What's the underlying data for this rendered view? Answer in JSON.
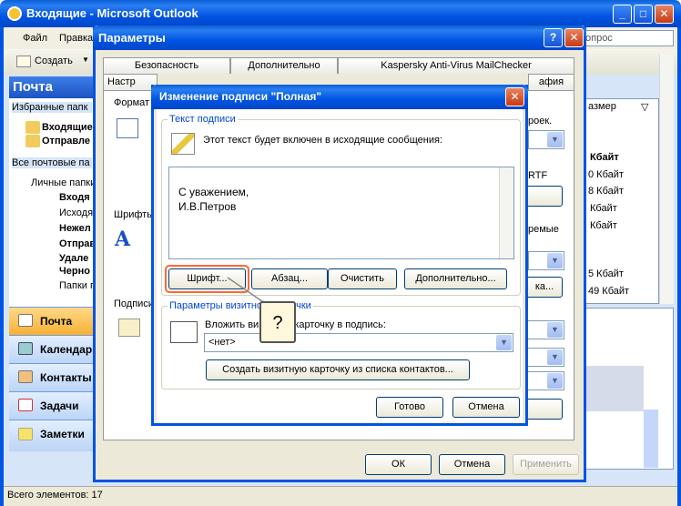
{
  "outlook": {
    "title": "Входящие - Microsoft Outlook",
    "menu": [
      "Файл",
      "Правка"
    ],
    "toolbar_create": "Создать",
    "question_placeholder": "опрос",
    "nav_header": "Почта",
    "favorites_label": "Избранные папк",
    "favorites": [
      "Входящие",
      "Отправле"
    ],
    "all_folders_label": "Все почтовые па",
    "folders": [
      "Личные папки",
      "Входя",
      "Исходя",
      "Нежел",
      "Отправ",
      "Удале",
      "Черно",
      "Папки п"
    ],
    "nav_buttons": [
      "Почта",
      "Календарь",
      "Контакты",
      "Задачи",
      "Заметки"
    ],
    "status": "Всего элементов: 17",
    "list_header_size": "азмер",
    "list_header_col": "Кбайт",
    "sizes": [
      "0 Кбайт",
      "8 Кбайт",
      "Кбайт",
      "Кбайт",
      "5 Кбайт",
      "49 Кбайт"
    ]
  },
  "params": {
    "title": "Параметры",
    "tabs_top": [
      "Безопасность",
      "Дополнительно",
      "Kaspersky Anti-Virus MailChecker"
    ],
    "tabs_bottom": [
      "Настр",
      "афия"
    ],
    "section_format": "Формат",
    "section_fonts": "Шрифты",
    "section_signatures": "Подписи",
    "partial_labels": [
      "роек.",
      "RTF",
      "ремые"
    ],
    "partial_button": "ка...",
    "ok": "ОК",
    "cancel": "Отмена",
    "apply": "Применить"
  },
  "dialog": {
    "title": "Изменение подписи \"Полная\"",
    "group_text": "Текст подписи",
    "hint": "Этот текст будет включен в исходящие сообщения:",
    "signature_lines": [
      "С уважением,",
      "И.В.Петров"
    ],
    "btn_font": "Шрифт...",
    "btn_paragraph": "Абзац...",
    "btn_clear": "Очистить",
    "btn_more": "Дополнительно...",
    "group_vcard": "Параметры визитной карточки",
    "vcard_label": "Вложить визитную карточку в подпись:",
    "vcard_value": "<нет>",
    "btn_create_vcard": "Создать визитную карточку из списка контактов...",
    "ok": "Готово",
    "cancel": "Отмена"
  },
  "callout": {
    "text": "?"
  },
  "colors": {
    "xp_blue": "#0054e3",
    "highlight": "#ff6633",
    "nav_blue": "#bcd4f6"
  }
}
